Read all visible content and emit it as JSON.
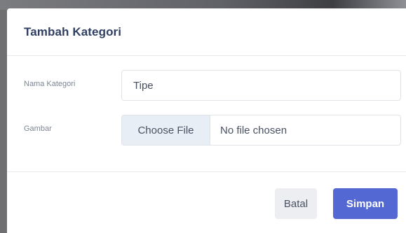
{
  "modal": {
    "title": "Tambah Kategori"
  },
  "form": {
    "name": {
      "label": "Nama Kategori",
      "value": "Tipe"
    },
    "image": {
      "label": "Gambar",
      "button_label": "Choose File",
      "status": "No file chosen"
    }
  },
  "footer": {
    "cancel_label": "Batal",
    "save_label": "Simpan"
  },
  "colors": {
    "primary": "#5468d4",
    "title": "#2f3f63",
    "secondary_button": "#eceef1"
  }
}
